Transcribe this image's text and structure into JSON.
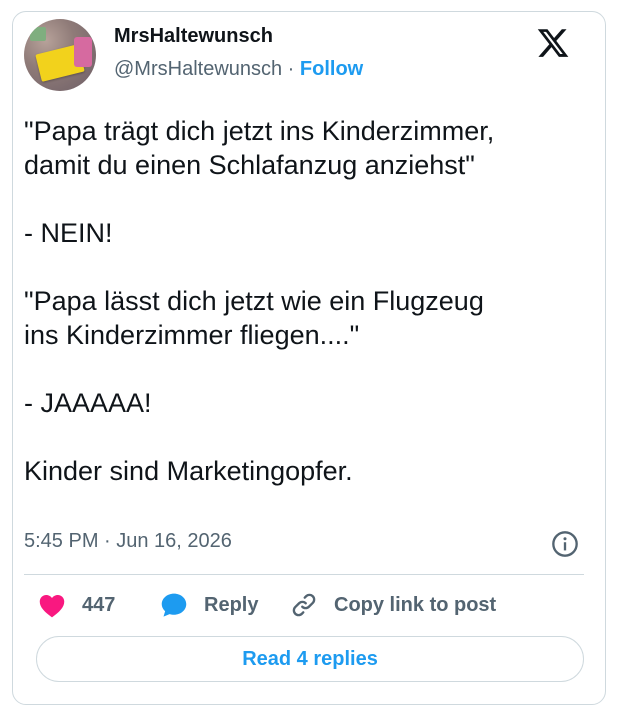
{
  "author": {
    "display_name": "MrsHaltewunsch",
    "handle": "@MrsHaltewunsch",
    "separator": " · ",
    "follow_label": "Follow"
  },
  "platform_icon": "x-logo-icon",
  "tweet": {
    "paragraphs": [
      "\"Papa trägt dich jetzt ins Kinderzimmer,",
      "damit du einen Schlafanzug anziehst\"",
      "- NEIN!",
      "\"Papa lässt dich jetzt wie ein Flugzeug",
      "ins Kinderzimmer fliegen....\"",
      "- JAAAAA!",
      "Kinder sind Marketingopfer."
    ],
    "timestamp": "5:45 PM · Jun 16, 2026"
  },
  "actions": {
    "like_count": "447",
    "reply_label": "Reply",
    "copy_link_label": "Copy link to post"
  },
  "read_replies_label": "Read 4 replies",
  "colors": {
    "accent": "#1d9bf0",
    "like": "#f91880",
    "text": "#0f1419",
    "muted": "#536471",
    "border": "#cfd9de"
  }
}
